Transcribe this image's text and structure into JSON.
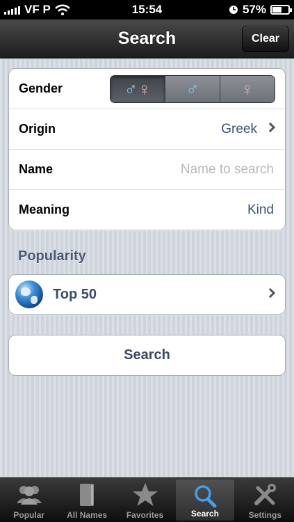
{
  "status_bar": {
    "carrier": "VF P",
    "time": "15:54",
    "battery_percent": "57%",
    "battery_level": 0.57
  },
  "nav": {
    "title": "Search",
    "clear_label": "Clear"
  },
  "form": {
    "gender": {
      "label": "Gender",
      "options": [
        {
          "icon": "male-female-icon",
          "glyphs": "♂♀",
          "selected": true
        },
        {
          "icon": "male-icon",
          "glyphs": "♂",
          "selected": false
        },
        {
          "icon": "female-icon",
          "glyphs": "♀",
          "selected": false
        }
      ]
    },
    "origin": {
      "label": "Origin",
      "value": "Greek"
    },
    "name": {
      "label": "Name",
      "value": "",
      "placeholder": "Name to search"
    },
    "meaning": {
      "label": "Meaning",
      "value": "Kind"
    }
  },
  "popularity": {
    "header": "Popularity",
    "item_label": "Top 50",
    "icon": "globe-icon"
  },
  "search_button": {
    "label": "Search"
  },
  "tabs": [
    {
      "label": "Popular",
      "icon": "people-icon",
      "active": false
    },
    {
      "label": "All Names",
      "icon": "book-icon",
      "active": false
    },
    {
      "label": "Favorites",
      "icon": "star-icon",
      "active": false
    },
    {
      "label": "Search",
      "icon": "search-icon",
      "active": true
    },
    {
      "label": "Settings",
      "icon": "tools-icon",
      "active": false
    }
  ],
  "colors": {
    "accent_text": "#3a4a68",
    "male": "#8cc3ee",
    "female": "#f0a3ad"
  }
}
